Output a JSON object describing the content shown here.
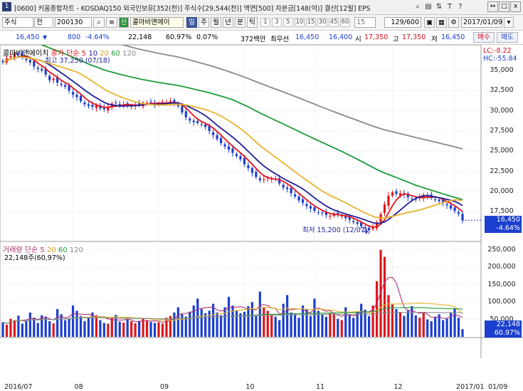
{
  "titlebar": {
    "window_num": "1",
    "title": "[0600] 키움종합차트 - KOSDAQ150 외국인보유[352(천)] 주식수[29,544(천)] 액면[500] 자본금[148(억)] 결산[12월] EPS",
    "icons": [
      "search-icon",
      "folder-icon",
      "sort-icon",
      "text-tool-icon",
      "help-icon"
    ],
    "win_buttons": [
      "↔",
      "□",
      "x"
    ]
  },
  "toolbar": {
    "market": "주식",
    "prefix": "전",
    "code": "200130",
    "credit": "신",
    "stock_name": "콜마비앤에이",
    "period_buttons": [
      "일",
      "주",
      "월",
      "년",
      "분",
      "틱"
    ],
    "period_selected": 0,
    "minute_cells": [
      "1",
      "3",
      "5",
      "10",
      "15",
      "30",
      "45",
      "60",
      "15"
    ],
    "count": "129",
    "total": "/600",
    "date": "2017/01/09"
  },
  "quote": {
    "price": "16,450",
    "change": "800",
    "change_pct": "-4.64%",
    "volume": "22,148",
    "vol_ratio": "60.97%",
    "rate": "0.07%",
    "trade_value": "372백만",
    "best_label": "최우선",
    "bid": "16,450",
    "ask": "16,400",
    "open_label": "시",
    "open": "17,350",
    "high_label": "고",
    "high": "17,350",
    "low_label": "저",
    "low": "16,450",
    "buy_label": "매수",
    "sell_label": "매도"
  },
  "price_chart": {
    "legend_name": "콜마비앤에이치",
    "legend_type": "종가 단순",
    "ma_periods": [
      "5",
      "10",
      "20",
      "60",
      "120"
    ],
    "ma_colors": [
      "#e8141b",
      "#1e1e9a",
      "#e8b32a",
      "#1f9b3a",
      "#8a8a8a"
    ],
    "lc_label": "LC:-8.22",
    "hc_label": "HC:-55.84",
    "high_note": "최고 37,250 (07/18)",
    "low_note": "최저 15,200 (12/07)",
    "price_badge": "16,450",
    "pct_badge": "-4.64%",
    "y_ticks": [
      "35,000",
      "32,500",
      "30,000",
      "27,500",
      "25,000",
      "22,500",
      "20,000",
      "17,500"
    ]
  },
  "volume_chart": {
    "legend_name": "거래량",
    "legend_type": "단순",
    "ma_periods": [
      "5",
      "20",
      "60",
      "120"
    ],
    "ma_colors": [
      "#b0307a",
      "#e8b32a",
      "#1f9b3a",
      "#8a8a8a"
    ],
    "value_label": "22,148주(60,97%)",
    "volume_badge": "22,148",
    "ratio_badge": "60.97%",
    "y_ticks": [
      "250,000",
      "200,000",
      "150,000",
      "100,000",
      "50,000"
    ]
  },
  "x_axis": {
    "labels": [
      "2016/07",
      "08",
      "09",
      "10",
      "11",
      "12",
      "2017/01",
      "01/09"
    ]
  },
  "chart_data": {
    "type": "candlestick",
    "title": "콜마비앤에이치 종가 단순",
    "ylim_price": [
      14000,
      38000
    ],
    "ylim_volume": [
      0,
      270000
    ],
    "x_range": [
      "2016/07",
      "2017/01/09"
    ],
    "series": [
      {
        "name": "종가",
        "values": [
          36000,
          36500,
          36800,
          37100,
          37000,
          36600,
          36300,
          36000,
          35500,
          35200,
          35000,
          34500,
          33800,
          34000,
          33500,
          33200,
          33000,
          32500,
          32000,
          31700,
          31200,
          30800,
          30600,
          30500,
          30700,
          30300,
          30200,
          30500,
          30900,
          31000,
          30600,
          30800,
          30700,
          30600,
          30800,
          30700,
          31000,
          31000,
          31100,
          30800,
          30900,
          31100,
          31000,
          31200,
          31000,
          30600,
          29800,
          29200,
          28800,
          28600,
          28500,
          28300,
          28000,
          27500,
          27000,
          26500,
          26000,
          25600,
          25200,
          24800,
          24400,
          24000,
          23400,
          22900,
          22300,
          21800,
          21400,
          21500,
          21700,
          21600,
          21500,
          21000,
          20500,
          20300,
          19800,
          19400,
          18900,
          18600,
          18200,
          17900,
          17600,
          17400,
          17300,
          17100,
          17000,
          17200,
          17100,
          17000,
          16700,
          16500,
          16200,
          16000,
          15700,
          15500,
          15200,
          15600,
          16200,
          17200,
          18400,
          19500,
          19900,
          19700,
          19800,
          19600,
          19300,
          19100,
          19000,
          19300,
          19600,
          19500,
          19200,
          19000,
          18800,
          18600,
          18300,
          17900,
          17600,
          17250,
          16450
        ]
      },
      {
        "name": "거래량",
        "values": [
          42000,
          35000,
          52000,
          48000,
          61000,
          38000,
          45000,
          70000,
          55000,
          40000,
          62000,
          58000,
          45000,
          39000,
          80000,
          65000,
          48000,
          52000,
          90000,
          75000,
          60000,
          45000,
          55000,
          70000,
          62000,
          48000,
          40000,
          38000,
          56000,
          63000,
          44000,
          41000,
          50000,
          45000,
          39000,
          46000,
          52000,
          48000,
          43000,
          40000,
          42000,
          38000,
          55000,
          60000,
          70000,
          85000,
          65000,
          58000,
          72000,
          90000,
          110000,
          80000,
          68000,
          75000,
          95000,
          70000,
          62000,
          85000,
          115000,
          90000,
          75000,
          68000,
          72000,
          88000,
          100000,
          60000,
          130000,
          85000,
          75000,
          62000,
          58000,
          48000,
          95000,
          120000,
          70000,
          65000,
          55000,
          90000,
          80000,
          60000,
          110000,
          75000,
          65000,
          58000,
          70000,
          66000,
          52000,
          48000,
          85000,
          62000,
          55000,
          70000,
          95000,
          78000,
          60000,
          90000,
          160000,
          250000,
          230000,
          120000,
          95000,
          80000,
          70000,
          60000,
          75000,
          88000,
          62000,
          55000,
          70000,
          50000,
          45000,
          58000,
          65000,
          48000,
          52000,
          70000,
          80000,
          55000,
          22148
        ]
      }
    ],
    "moving_averages": [
      "5",
      "10",
      "20",
      "60",
      "120"
    ]
  }
}
